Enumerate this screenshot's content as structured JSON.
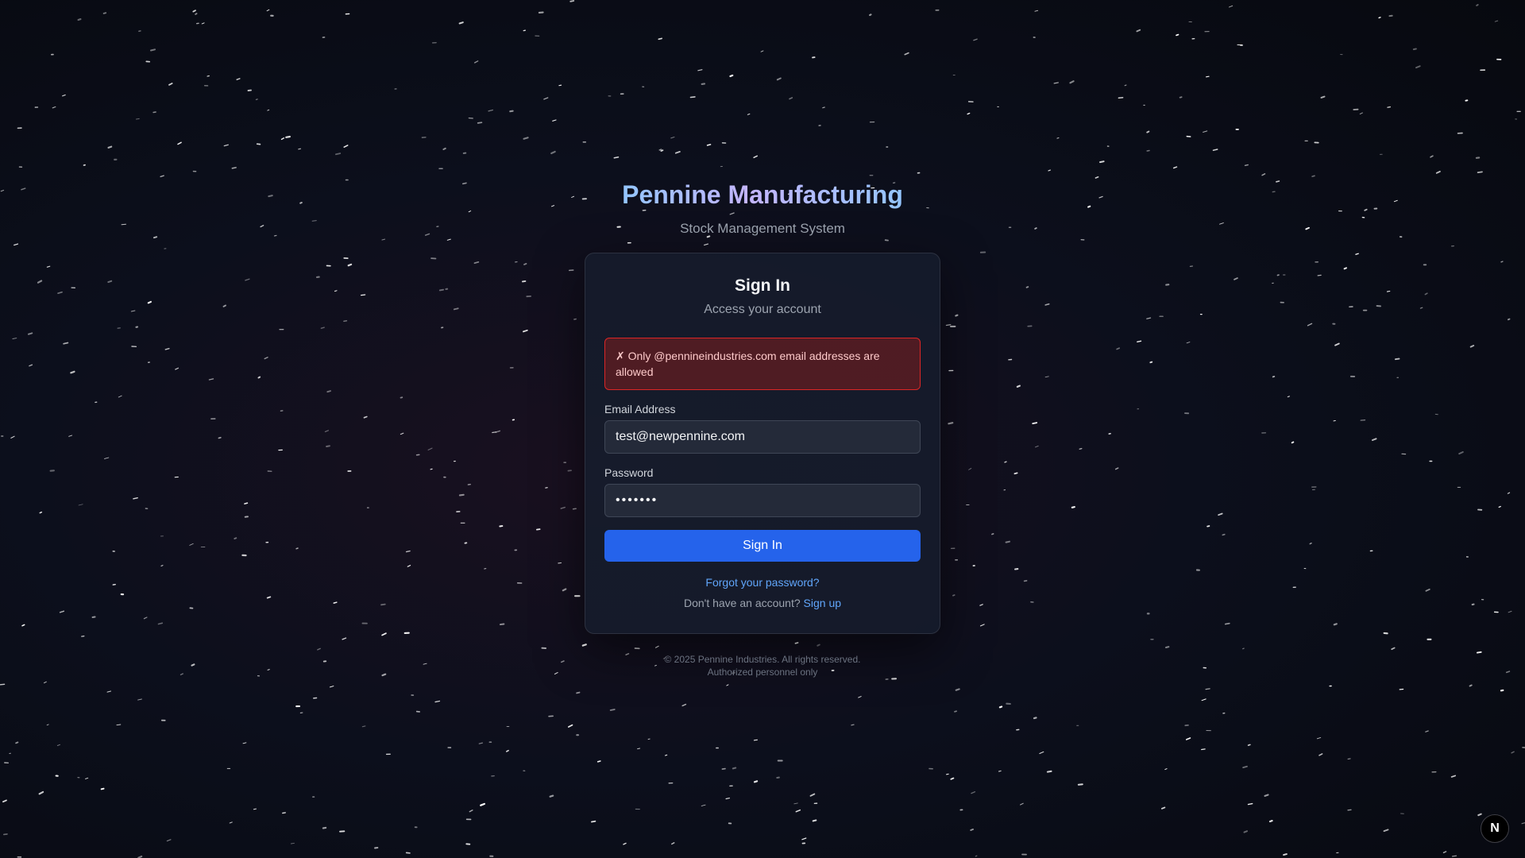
{
  "brand": {
    "title": "Pennine Manufacturing",
    "subtitle": "Stock Management System"
  },
  "card": {
    "title": "Sign In",
    "subtitle": "Access your account",
    "error": "✗ Only @pennineindustries.com email addresses are allowed",
    "email": {
      "label": "Email Address",
      "value": "test@newpennine.com"
    },
    "password": {
      "label": "Password",
      "value": "•••••••"
    },
    "submit_label": "Sign In",
    "forgot_label": "Forgot your password?",
    "signup_prompt": "Don't have an account?",
    "signup_label": "Sign up"
  },
  "footer": {
    "copyright": "© 2025 Pennine Industries. All rights reserved.",
    "notice": "Authorized personnel only"
  },
  "corner_badge": {
    "label": "N",
    "icon": "nextjs-logo-icon"
  },
  "colors": {
    "accent": "#2563eb",
    "link": "#60a5fa",
    "error_border": "#dc2626",
    "error_text": "#fecaca",
    "title_gradient_start": "#93c5fd",
    "title_gradient_mid": "#c4b5fd"
  }
}
